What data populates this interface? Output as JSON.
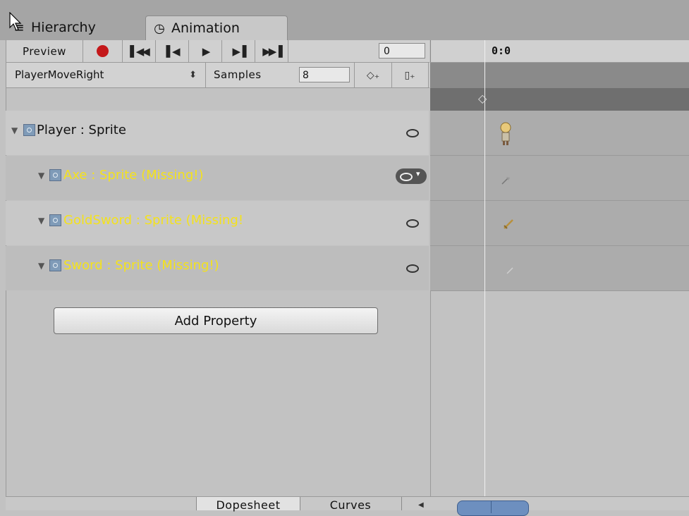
{
  "tabs": [
    {
      "label": "Hierarchy",
      "icon": "list-icon",
      "active": false
    },
    {
      "label": "Animation",
      "icon": "clock-icon",
      "active": true
    }
  ],
  "toolbar": {
    "preview_label": "Preview",
    "record_icon": "record-icon",
    "first_icon": "first-key-icon",
    "prev_icon": "prev-key-icon",
    "play_icon": "play-icon",
    "next_icon": "next-key-icon",
    "last_icon": "last-key-icon",
    "frame_value": "0",
    "record_color": "#c4181a"
  },
  "clip": {
    "name": "PlayerMoveRight",
    "samples_label": "Samples",
    "samples_value": "8",
    "add_keyframe_icon": "add-keyframe-icon",
    "add_event_icon": "add-event-icon"
  },
  "timeline": {
    "current_time": "0:0",
    "summary_key_icon": "diamond-key-icon"
  },
  "properties": [
    {
      "label": "Player : Sprite",
      "missing": false,
      "sprite": "player-sprite-icon"
    },
    {
      "label": "Axe : Sprite (Missing!)",
      "missing": true,
      "sprite": "axe-sprite-icon"
    },
    {
      "label": "GoldSword : Sprite (Missing!",
      "missing": true,
      "sprite": "gold-sword-sprite-icon"
    },
    {
      "label": "Sword : Sprite (Missing!)",
      "missing": true,
      "sprite": "sword-sprite-icon"
    }
  ],
  "add_property_label": "Add Property",
  "bottom_tabs": {
    "dopesheet": "Dopesheet",
    "curves": "Curves"
  },
  "colors": {
    "missing_text": "#f4e21c",
    "scroll_thumb": "#6d8fbf"
  }
}
